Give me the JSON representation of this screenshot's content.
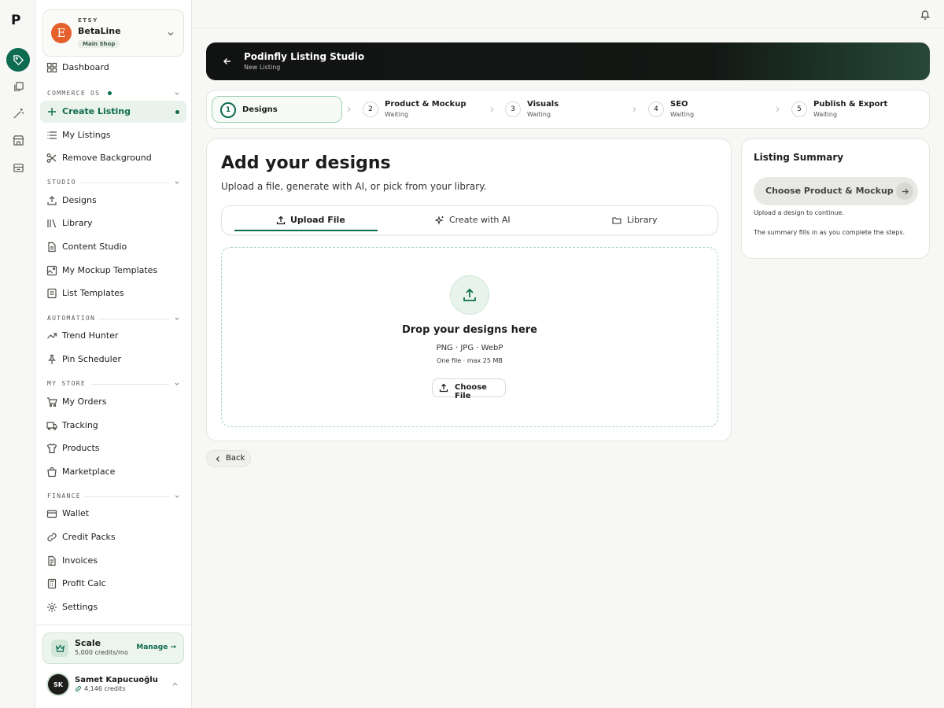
{
  "rail": {
    "logo": "P",
    "icons": [
      "tag-icon",
      "layers-icon",
      "magic-wand-icon",
      "store-icon",
      "archive-icon"
    ]
  },
  "shop": {
    "platform": "ETSY",
    "logo_letter": "E",
    "name": "BetaLine",
    "badge": "Main Shop"
  },
  "sidebar": {
    "dashboard": "Dashboard",
    "sections": {
      "commerce": "COMMERCE OS",
      "studio": "STUDIO",
      "automation": "AUTOMATION",
      "store": "MY STORE",
      "finance": "FINANCE"
    },
    "commerce_items": [
      "Create Listing",
      "My Listings",
      "Remove Background"
    ],
    "studio_items": [
      "Designs",
      "Library",
      "Content Studio",
      "My Mockup Templates",
      "List Templates"
    ],
    "automation_items": [
      "Trend Hunter",
      "Pin Scheduler"
    ],
    "store_items": [
      "My Orders",
      "Tracking",
      "Products",
      "Marketplace"
    ],
    "finance_items": [
      "Wallet",
      "Credit Packs",
      "Invoices",
      "Profit Calc"
    ],
    "settings": "Settings"
  },
  "plan": {
    "name": "Scale",
    "credits": "5,000 credits/mo",
    "manage": "Manage →"
  },
  "user": {
    "initials": "SK",
    "name": "Samet Kapucuoğlu",
    "credits": "4,146 credits"
  },
  "banner": {
    "title": "Podinfly Listing Studio",
    "subtitle": "New Listing"
  },
  "steps": [
    {
      "num": "1",
      "label": "Designs",
      "status": ""
    },
    {
      "num": "2",
      "label": "Product & Mockup",
      "status": "Waiting"
    },
    {
      "num": "3",
      "label": "Visuals",
      "status": "Waiting"
    },
    {
      "num": "4",
      "label": "SEO",
      "status": "Waiting"
    },
    {
      "num": "5",
      "label": "Publish & Export",
      "status": "Waiting"
    }
  ],
  "main": {
    "title": "Add your designs",
    "subtitle": "Upload a file, generate with AI, or pick from your library.",
    "tabs": [
      "Upload File",
      "Create with AI",
      "Library"
    ],
    "drop": {
      "title": "Drop your designs here",
      "formats": "PNG · JPG · WebP",
      "limit": "One file · max 25 MB",
      "button": "Choose File"
    },
    "back": "Back"
  },
  "summary": {
    "title": "Listing Summary",
    "button": "Choose Product & Mockup",
    "hint": "Upload a design to continue.",
    "note": "The summary fills in as you complete the steps."
  },
  "colors": {
    "accent": "#0d6b4f",
    "etsy": "#e5602b"
  }
}
